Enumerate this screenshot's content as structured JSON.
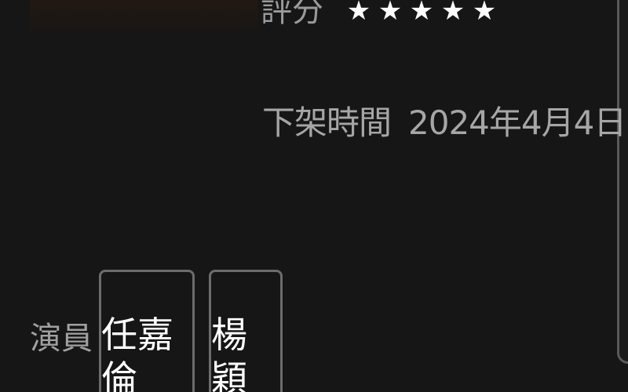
{
  "rating": {
    "label": "評分",
    "stars": [
      "★",
      "★",
      "★",
      "★",
      "★"
    ]
  },
  "removal": {
    "label": "下架時間",
    "date": "2024年4月4日"
  },
  "cast": {
    "label": "演員",
    "members": [
      "任嘉倫",
      "楊穎"
    ]
  },
  "colors": {
    "background": "#161616",
    "label_text": "#a6a6a6",
    "chip_border": "#6c6c6c",
    "chip_text": "#ffffff",
    "star": "#ffffff"
  }
}
